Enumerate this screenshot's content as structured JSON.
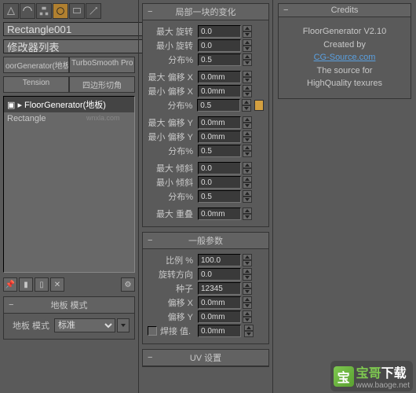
{
  "left": {
    "object_name": "Rectangle001",
    "modifier_list_label": "修改器列表",
    "tabs1": [
      "oorGenerator(地板",
      "TurboSmooth Pro"
    ],
    "tabs2": [
      "Tension",
      "四边形切角"
    ],
    "stack_items": [
      {
        "label": "▣ ▸ FloorGenerator(地板)",
        "selected": true
      },
      {
        "label": "    Rectangle",
        "selected": false
      }
    ]
  },
  "floor_mode": {
    "header": "地板 模式",
    "label": "地板 模式",
    "value": "标准"
  },
  "local_variation": {
    "header": "局部一块的变化",
    "rows": [
      {
        "label": "最大 旋转",
        "value": "0.0"
      },
      {
        "label": "最小 旋转",
        "value": "0.0"
      },
      {
        "label": "分布%",
        "value": "0.5"
      },
      {
        "label": "最大 偏移 X",
        "value": "0.0mm"
      },
      {
        "label": "最小 偏移 X",
        "value": "0.0mm"
      },
      {
        "label": "分布%",
        "value": "0.5"
      },
      {
        "label": "最大 偏移 Y",
        "value": "0.0mm"
      },
      {
        "label": "最小 偏移 Y",
        "value": "0.0mm"
      },
      {
        "label": "分布%",
        "value": "0.5"
      },
      {
        "label": "最大 倾斜",
        "value": "0.0"
      },
      {
        "label": "最小 倾斜",
        "value": "0.0"
      },
      {
        "label": "分布%",
        "value": "0.5"
      },
      {
        "label": "最大 重叠",
        "value": "0.0mm"
      }
    ]
  },
  "general_params": {
    "header": "一般参数",
    "rows": [
      {
        "label": "比例 %",
        "value": "100.0"
      },
      {
        "label": "旋转方向",
        "value": "0.0"
      },
      {
        "label": "种子",
        "value": "12345"
      },
      {
        "label": "偏移 X",
        "value": "0.0mm"
      },
      {
        "label": "偏移 Y",
        "value": "0.0mm"
      }
    ],
    "weld_label": "焊接 值.",
    "weld_value": "0.0mm"
  },
  "uv_settings": {
    "header": "UV 设置"
  },
  "credits": {
    "header": "Credits",
    "line1": "FloorGenerator V2.10",
    "line2": "Created by",
    "link": "CG-Source.com",
    "line3": "The source for",
    "line4": "HighQuality texures"
  },
  "watermark": {
    "brand_cn": "宝哥",
    "brand_suffix": "下载",
    "url": "www.baoge.net",
    "small": "wnxla.com"
  }
}
